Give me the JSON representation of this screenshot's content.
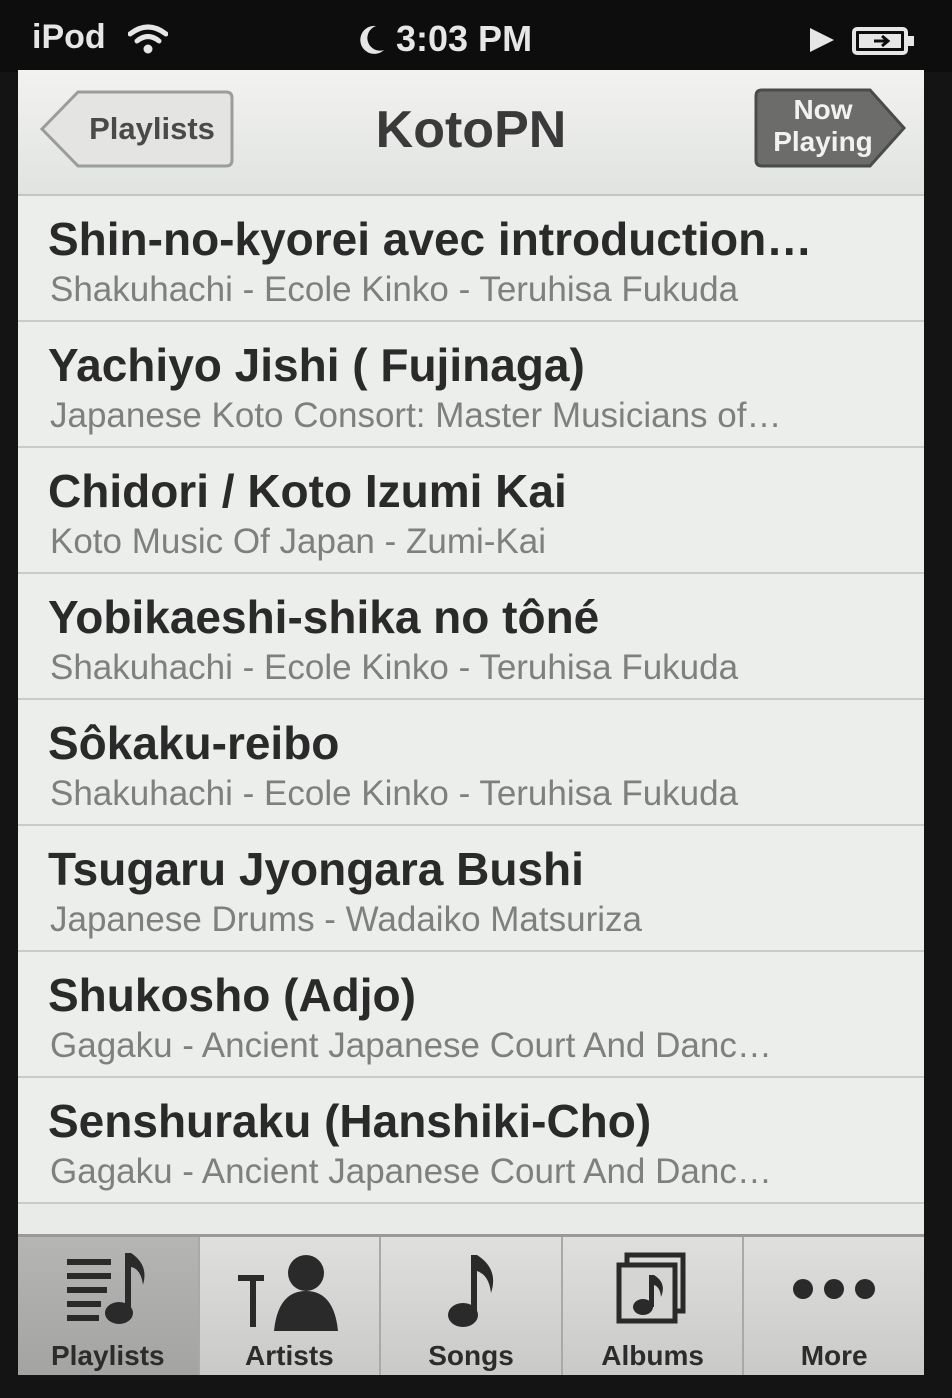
{
  "status_bar": {
    "carrier": "iPod",
    "time": "3:03 PM"
  },
  "nav": {
    "back_label": "Playlists",
    "title": "KotoPN",
    "now_playing_line1": "Now",
    "now_playing_line2": "Playing"
  },
  "songs": [
    {
      "title": "Shin-no-kyorei avec introduction…",
      "subtitle": "Shakuhachi - Ecole Kinko - Teruhisa Fukuda"
    },
    {
      "title": "Yachiyo Jishi ( Fujinaga)",
      "subtitle": "Japanese Koto Consort: Master Musicians of…"
    },
    {
      "title": "Chidori / Koto Izumi Kai",
      "subtitle": "Koto Music Of Japan - Zumi-Kai"
    },
    {
      "title": "Yobikaeshi-shika no tôné",
      "subtitle": "Shakuhachi - Ecole Kinko - Teruhisa Fukuda"
    },
    {
      "title": "Sôkaku-reibo",
      "subtitle": "Shakuhachi - Ecole Kinko - Teruhisa Fukuda"
    },
    {
      "title": "Tsugaru Jyongara Bushi",
      "subtitle": "Japanese Drums - Wadaiko Matsuriza"
    },
    {
      "title": "Shukosho (Adjo)",
      "subtitle": "Gagaku - Ancient Japanese Court And Danc…"
    },
    {
      "title": "Senshuraku (Hanshiki-Cho)",
      "subtitle": "Gagaku - Ancient Japanese Court And Danc…"
    }
  ],
  "tabs": [
    {
      "label": "Playlists",
      "icon": "playlists-icon",
      "active": true
    },
    {
      "label": "Artists",
      "icon": "artists-icon",
      "active": false
    },
    {
      "label": "Songs",
      "icon": "songs-icon",
      "active": false
    },
    {
      "label": "Albums",
      "icon": "albums-icon",
      "active": false
    },
    {
      "label": "More",
      "icon": "more-icon",
      "active": false
    }
  ]
}
